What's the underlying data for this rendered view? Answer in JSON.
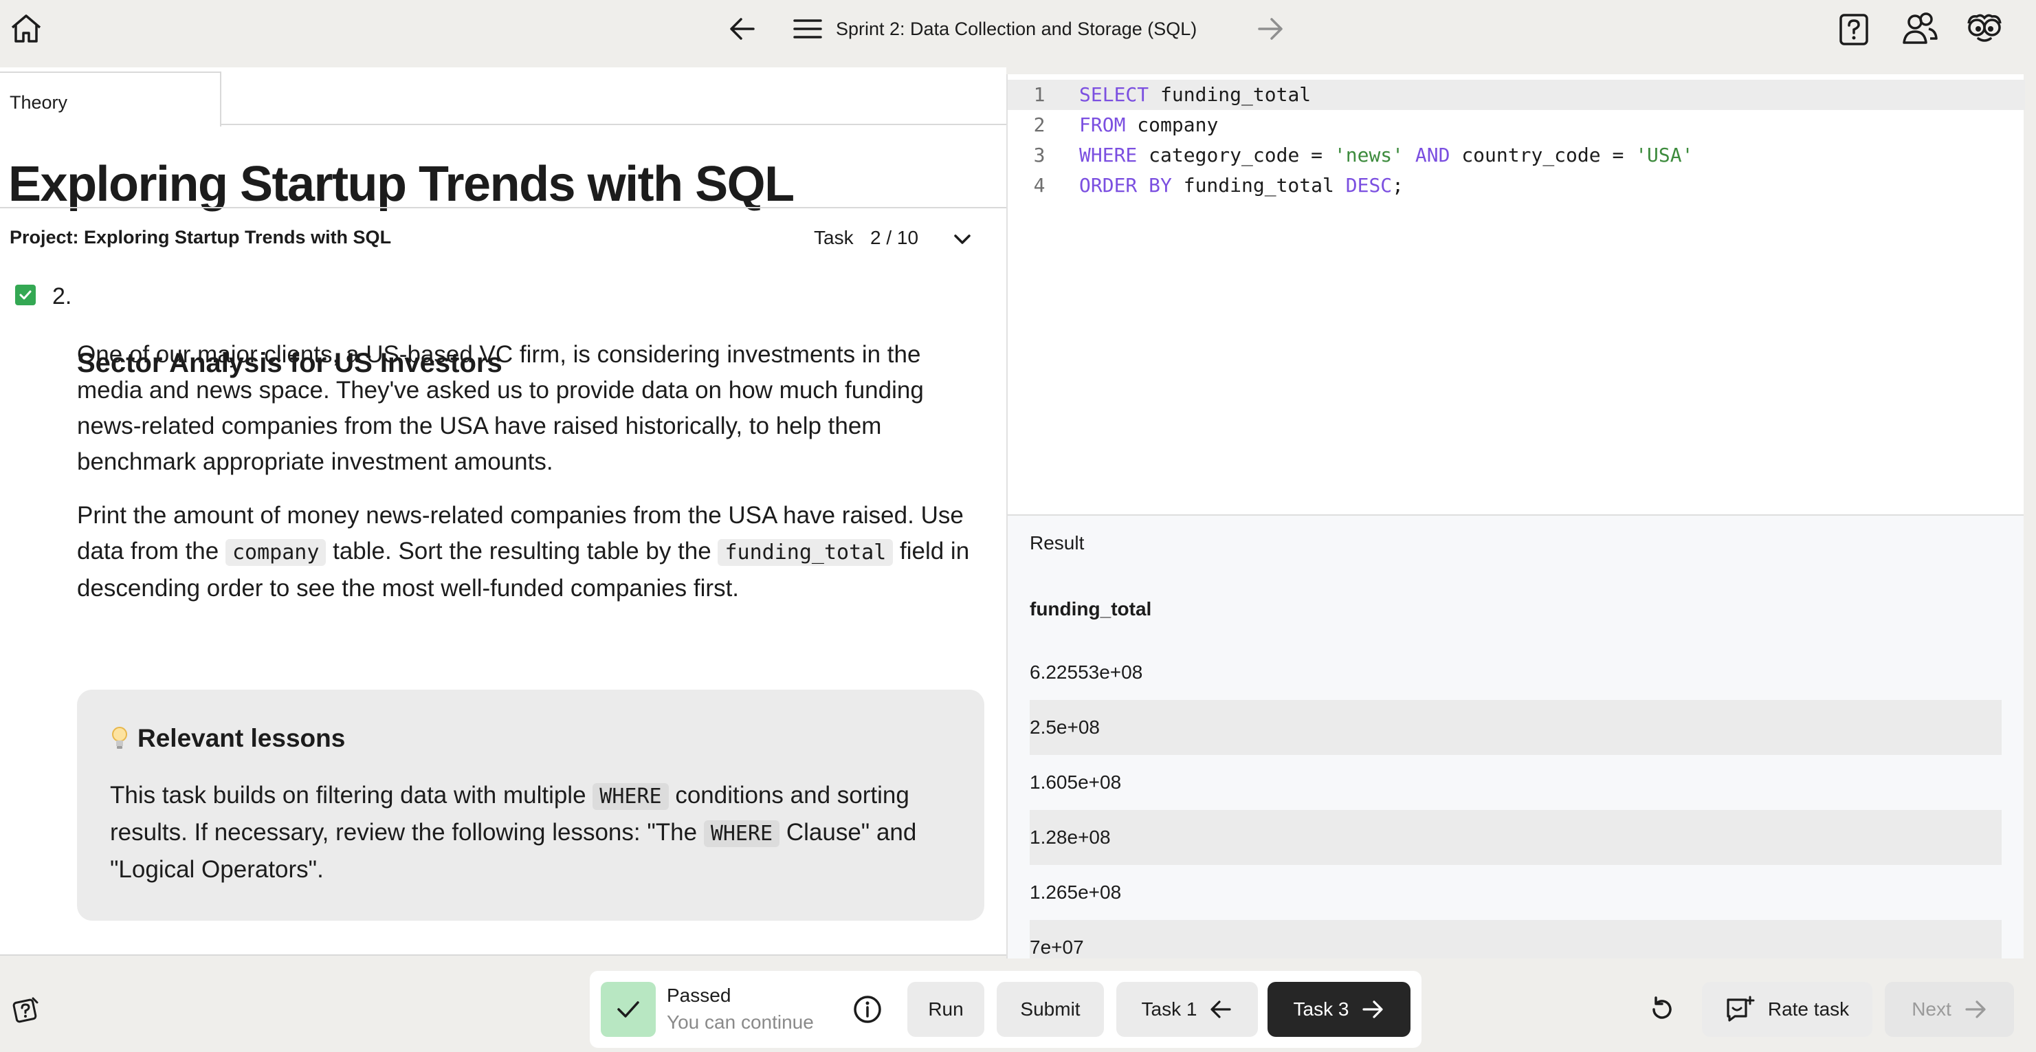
{
  "topbar": {
    "title": "Sprint 2: Data Collection and Storage (SQL)",
    "icons": [
      "home-icon",
      "arrow-left-icon",
      "menu-icon",
      "arrow-right-icon",
      "help-icon",
      "community-icon",
      "mascot-icon"
    ]
  },
  "left_panel": {
    "tab": "Theory",
    "lesson_title": "Exploring Startup Trends with SQL",
    "project_label": "Project: Exploring Startup Trends with SQL",
    "task_word": "Task",
    "task_count": "2 / 10",
    "task": {
      "number": "2.",
      "heading": "Sector Analysis for US Investors",
      "completed": true,
      "paragraph1": "One of our major clients, a US-based VC firm, is considering investments in the media and news space. They've asked us to provide data on how much funding news-related companies from the USA have raised historically, to help them benchmark appropriate investment amounts.",
      "paragraph2": {
        "part1": "Print the amount of money news-related companies from the USA have raised. Use data from the ",
        "code1": "company",
        "part2": " table. Sort the resulting table by the ",
        "code2": "funding_total",
        "part3": " field in descending order to see the most well-funded companies first."
      }
    },
    "relevant_lessons": {
      "title": "Relevant lessons",
      "part1": "This task builds on filtering data with multiple ",
      "code1": "WHERE",
      "part2": " conditions and sorting results. If necessary, review the following lessons: \"The ",
      "code2": "WHERE",
      "part3": " Clause\" and \"Logical Operators\"."
    }
  },
  "editor": {
    "lines": [
      {
        "no": "1"
      },
      {
        "no": "2"
      },
      {
        "no": "3"
      },
      {
        "no": "4"
      }
    ],
    "code": {
      "l1_kw": "SELECT",
      "l1_rest": " funding_total",
      "l2_kw": "FROM",
      "l2_rest": " company",
      "l3_kw1": "WHERE",
      "l3_a": " category_code = ",
      "l3_str1": "'news'",
      "l3_kw2": " AND",
      "l3_b": " country_code = ",
      "l3_str2": "'USA'",
      "l4_kw": "ORDER BY",
      "l4_a": " funding_total ",
      "l4_kw2": "DESC",
      "l4_end": ";"
    }
  },
  "result": {
    "label": "Result",
    "column": "funding_total",
    "rows": [
      "6.22553e+08",
      "2.5e+08",
      "1.605e+08",
      "1.28e+08",
      "1.265e+08",
      "7e+07"
    ]
  },
  "bottom": {
    "status_title": "Passed",
    "status_sub": "You can continue",
    "run": "Run",
    "submit": "Submit",
    "task_prev": "Task 1",
    "task_next": "Task 3",
    "rate": "Rate task",
    "next": "Next"
  },
  "colors": {
    "keyword": "#7b4fe0",
    "string": "#3d8b3d",
    "passed_badge": "#b8e7c2",
    "checkbox": "#34a853"
  }
}
